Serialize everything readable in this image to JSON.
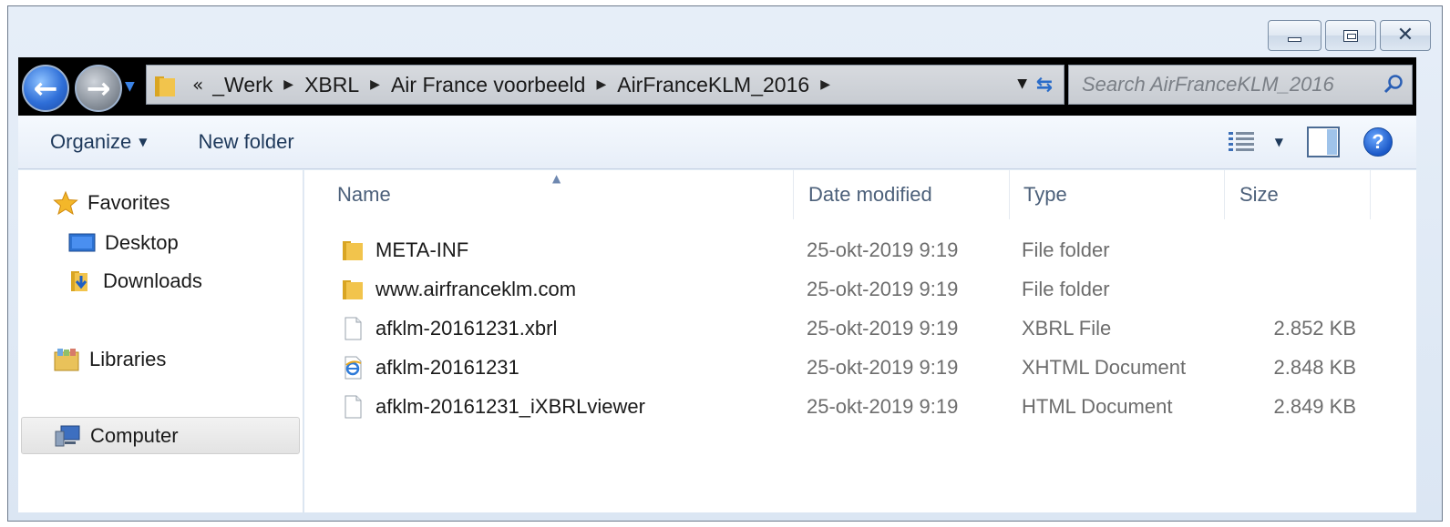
{
  "window": {
    "controls": {
      "minimize": "minimize-icon",
      "maximize": "maximize-icon",
      "close": "close-icon"
    }
  },
  "address": {
    "prefix": "«",
    "crumbs": [
      "_Werk",
      "XBRL",
      "Air France voorbeeld",
      "AirFranceKLM_2016"
    ]
  },
  "search": {
    "placeholder": "Search AirFranceKLM_2016"
  },
  "toolbar": {
    "organize": "Organize",
    "new_folder": "New folder",
    "help": "?"
  },
  "navpane": {
    "favorites": "Favorites",
    "desktop": "Desktop",
    "downloads": "Downloads",
    "libraries": "Libraries",
    "computer": "Computer"
  },
  "columns": {
    "name": "Name",
    "date": "Date modified",
    "type": "Type",
    "size": "Size"
  },
  "files": [
    {
      "name": "META-INF",
      "date": "25-okt-2019 9:19",
      "type": "File folder",
      "size": "",
      "icon": "folder-icon"
    },
    {
      "name": "www.airfranceklm.com",
      "date": "25-okt-2019 9:19",
      "type": "File folder",
      "size": "",
      "icon": "folder-icon"
    },
    {
      "name": "afklm-20161231.xbrl",
      "date": "25-okt-2019 9:19",
      "type": "XBRL File",
      "size": "2.852 KB",
      "icon": "generic-file-icon"
    },
    {
      "name": "afklm-20161231",
      "date": "25-okt-2019 9:19",
      "type": "XHTML Document",
      "size": "2.848 KB",
      "icon": "ie-document-icon"
    },
    {
      "name": "afklm-20161231_iXBRLviewer",
      "date": "25-okt-2019 9:19",
      "type": "HTML Document",
      "size": "2.849 KB",
      "icon": "generic-file-icon"
    }
  ],
  "colors": {
    "accent": "#1e395b",
    "toolbar_bg": "#eef3fa",
    "address_band": "#000000"
  }
}
